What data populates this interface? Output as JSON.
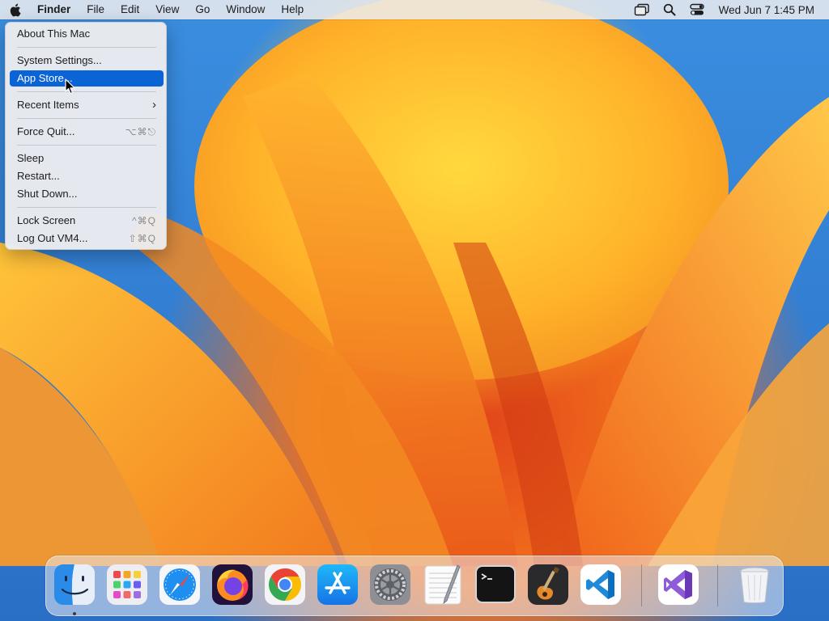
{
  "menubar": {
    "app_name": "Finder",
    "items": [
      "File",
      "Edit",
      "View",
      "Go",
      "Window",
      "Help"
    ],
    "status_icons": [
      "screen-mirroring-icon",
      "spotlight-search-icon",
      "control-center-icon"
    ],
    "clock": "Wed Jun 7  1:45 PM"
  },
  "apple_menu": {
    "about": "About This Mac",
    "system_settings": "System Settings...",
    "app_store": "App Store...",
    "recent_items": "Recent Items",
    "recent_items_arrow": "›",
    "force_quit": "Force Quit...",
    "force_quit_shortcut": "⌥⌘⎋",
    "sleep": "Sleep",
    "restart": "Restart...",
    "shut_down": "Shut Down...",
    "lock_screen": "Lock Screen",
    "lock_screen_shortcut": "^⌘Q",
    "log_out": "Log Out VM4...",
    "log_out_shortcut": "⇧⌘Q",
    "selected_item": "App Store..."
  },
  "dock": {
    "apps": [
      "finder-icon",
      "launchpad-icon",
      "safari-icon",
      "firefox-icon",
      "chrome-icon",
      "app-store-icon",
      "system-settings-icon",
      "textedit-icon",
      "terminal-icon",
      "garageband-icon",
      "vscode-icon",
      "visual-studio-icon",
      "trash-icon"
    ],
    "running_indicator": "finder-icon"
  },
  "colors": {
    "selection": "#0a64d6",
    "wallpaper_orange": "#f2701c",
    "wallpaper_blue": "#2e7fd6"
  }
}
